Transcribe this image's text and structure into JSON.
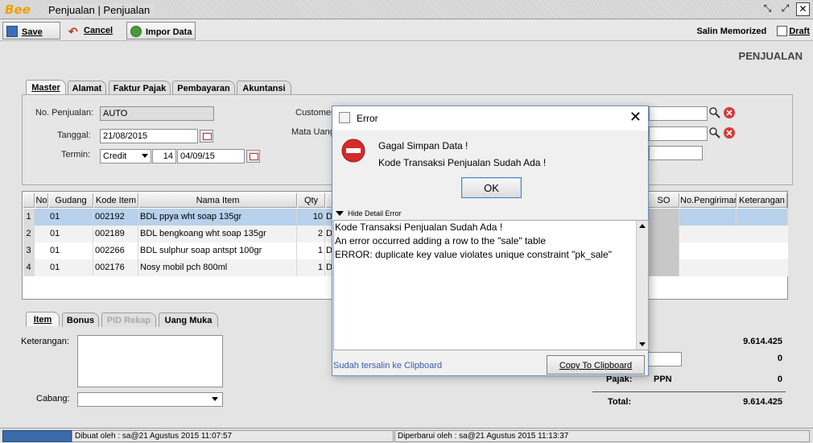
{
  "window": {
    "logo": "Bee",
    "title": "Penjualan | Penjualan"
  },
  "toolbar": {
    "save_label": "Save",
    "cancel_label": "Cancel",
    "import_label": "Impor Data",
    "salin_memorized": "Salin Memorized",
    "draft_label": "Draft",
    "draft_checked": false
  },
  "page_heading": "PENJUALAN",
  "tabs": [
    "Master",
    "Alamat",
    "Faktur Pajak",
    "Pembayaran",
    "Akuntansi"
  ],
  "master": {
    "no_penjualan_label": "No. Penjualan:",
    "no_penjualan_value": "AUTO",
    "tanggal_label": "Tanggal:",
    "tanggal_value": "21/08/2015",
    "termin_label": "Termin:",
    "termin_value": "Credit",
    "termin_days": "14",
    "termin_date": "04/09/15",
    "customer_label": "Customer",
    "mata_uang_label": "Mata Uang"
  },
  "grid": {
    "columns": [
      "No",
      "Gudang",
      "Kode Item",
      "Nama Item",
      "Qty",
      "SO",
      "No.Pengiriman",
      "Keterangan"
    ],
    "rows": [
      {
        "no": "1",
        "gudang": "01",
        "kode": "002192",
        "nama": "BDL ppya wht soap 135gr",
        "qty": "10",
        "unit": "D"
      },
      {
        "no": "2",
        "gudang": "01",
        "kode": "002189",
        "nama": "BDL bengkoang wht soap 135gr",
        "qty": "2",
        "unit": "D"
      },
      {
        "no": "3",
        "gudang": "01",
        "kode": "002266",
        "nama": "BDL sulphur soap antspt 100gr",
        "qty": "1",
        "unit": "D"
      },
      {
        "no": "4",
        "gudang": "01",
        "kode": "002176",
        "nama": "Nosy mobil pch 800ml",
        "qty": "1",
        "unit": "D"
      }
    ]
  },
  "bottom_tabs": [
    "Item",
    "Bonus",
    "PID Rekap",
    "Uang Muka"
  ],
  "bottom": {
    "keterangan_label": "Keterangan:",
    "cabang_label": "Cabang:",
    "subtotal_value": "9.614.425",
    "diskon_value": "0",
    "pajak_label": "Pajak:",
    "pajak_type": "PPN",
    "pajak_value": "0",
    "total_label": "Total:",
    "total_value": "9.614.425"
  },
  "status": {
    "dibuat": "Dibuat oleh : sa@21 Agustus 2015  11:07:57",
    "diperbarui": "Diperbarui oleh : sa@21 Agustus 2015  11:13:37"
  },
  "dialog": {
    "title": "Error",
    "message_line1": "Gagal Simpan Data !",
    "message_line2": "Kode Transaksi Penjualan Sudah Ada !",
    "ok_label": "OK",
    "detail_toggle": "Hide Detail Error",
    "detail_lines": [
      "Kode Transaksi Penjualan Sudah Ada !",
      "An error occurred adding a row to the \"sale\" table",
      "ERROR: duplicate key value violates unique constraint \"pk_sale\""
    ],
    "copied_note": "Sudah tersalin ke Clipboard",
    "copy_label": "Copy To Clipboard"
  },
  "colors": {
    "selected_row": "#b8d1ec",
    "error_red": "#d62a2a",
    "link_blue": "#3a5bb0"
  }
}
